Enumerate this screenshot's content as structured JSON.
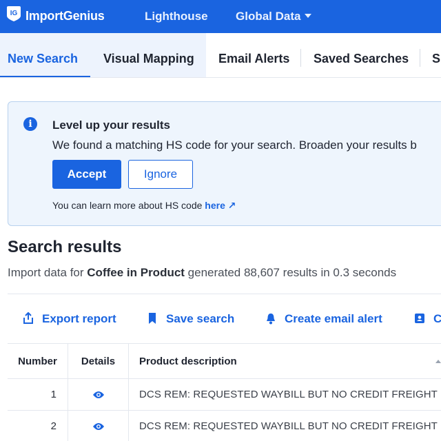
{
  "header": {
    "logo_badge": "IG",
    "brand": "ImportGenius",
    "nav": [
      {
        "label": "Lighthouse"
      },
      {
        "label": "Global Data"
      }
    ]
  },
  "tabs": [
    {
      "label": "New Search",
      "active": true
    },
    {
      "label": "Visual Mapping"
    },
    {
      "label": "Email Alerts"
    },
    {
      "label": "Saved Searches"
    },
    {
      "label": "S"
    }
  ],
  "alert": {
    "icon": "info-icon",
    "title": "Level up your results",
    "body": "We found a matching HS code for your search. Broaden your results b",
    "accept_label": "Accept",
    "ignore_label": "Ignore",
    "footer_text": "You can learn more about HS code ",
    "footer_link": "here ↗"
  },
  "results": {
    "title": "Search results",
    "sub_prefix": "Import data for ",
    "query": "Coffee in Product",
    "sub_suffix": " generated 88,607 results in 0.3 seconds"
  },
  "actions": [
    {
      "label": "Export report",
      "icon": "export-icon"
    },
    {
      "label": "Save search",
      "icon": "bookmark-icon"
    },
    {
      "label": "Create email alert",
      "icon": "bell-icon"
    },
    {
      "label": "C",
      "icon": "contact-card-icon"
    }
  ],
  "table": {
    "columns": [
      "Number",
      "Details",
      "Product description"
    ],
    "rows": [
      {
        "number": "1",
        "description": "DCS REM: REQUESTED WAYBILL BUT NO CREDIT FREIGHT ..."
      },
      {
        "number": "2",
        "description": "DCS REM: REQUESTED WAYBILL BUT NO CREDIT FREIGHT ..."
      }
    ]
  },
  "colors": {
    "brand_blue": "#1a64e0",
    "alert_bg": "#eef5fd"
  }
}
